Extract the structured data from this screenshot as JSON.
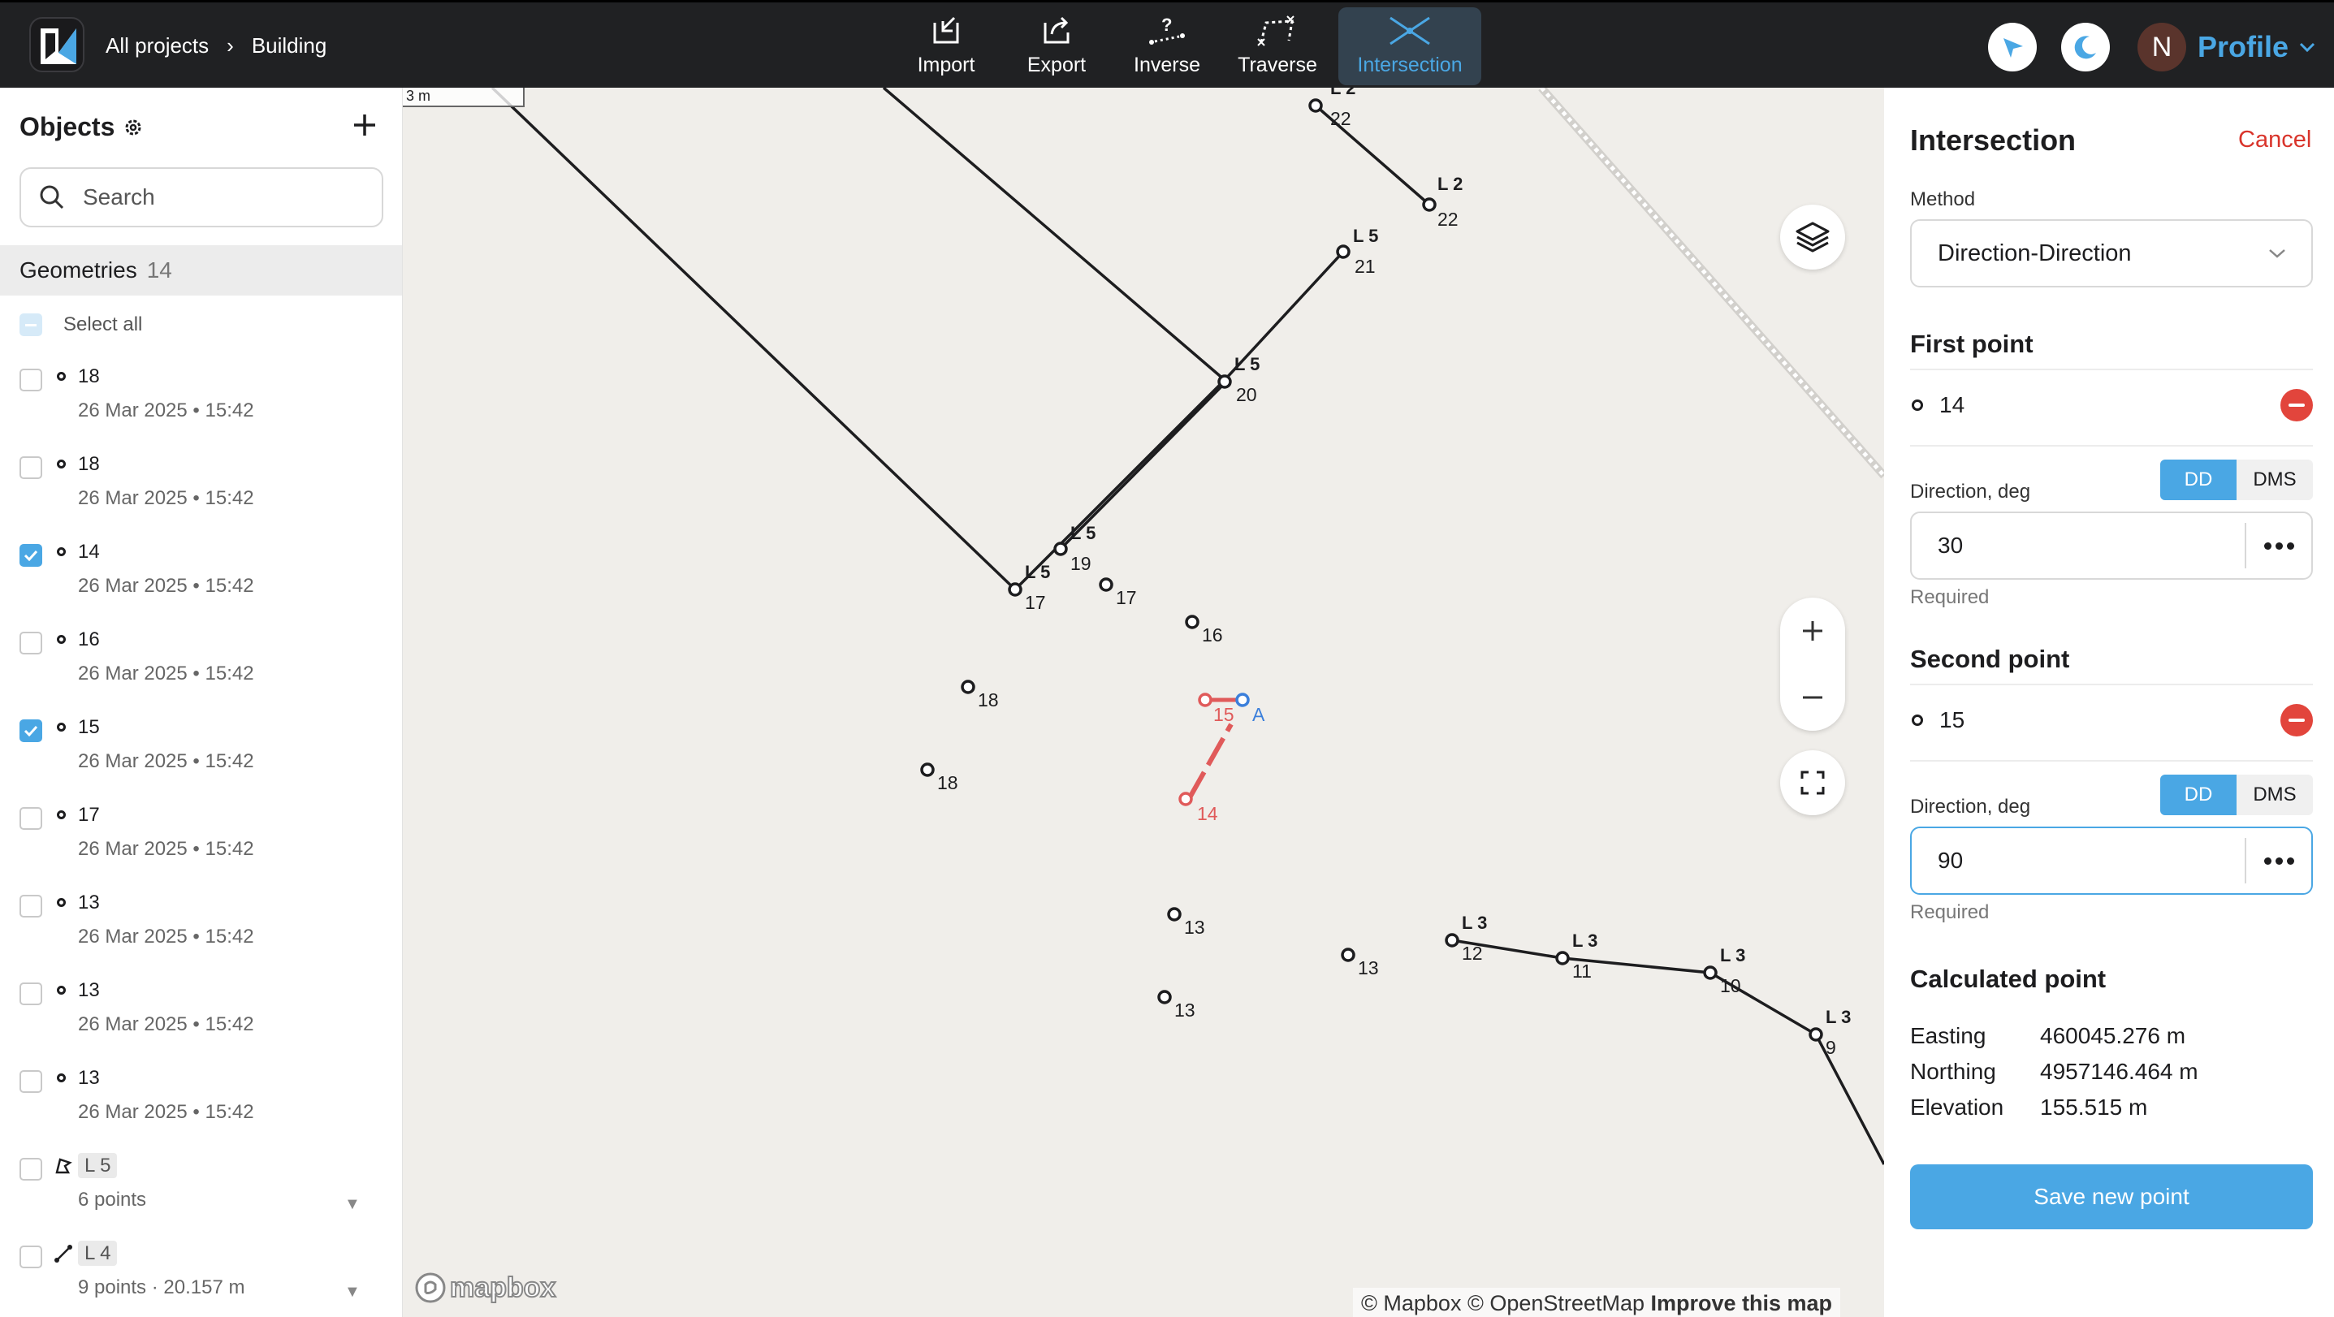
{
  "topbar": {
    "breadcrumb": [
      "All projects",
      "Building"
    ],
    "tools": [
      {
        "label": "Import",
        "icon": "import-icon"
      },
      {
        "label": "Export",
        "icon": "export-icon"
      },
      {
        "label": "Inverse",
        "icon": "inverse-icon"
      },
      {
        "label": "Traverse",
        "icon": "traverse-icon"
      },
      {
        "label": "Intersection",
        "icon": "intersection-icon",
        "active": true
      }
    ],
    "avatar_initial": "N",
    "profile_label": "Profile",
    "accent": "#4aa7e4"
  },
  "sidebar": {
    "title": "Objects",
    "search_placeholder": "Search",
    "geometries_label": "Geometries",
    "geometries_count": "14",
    "select_all": "Select all",
    "items": [
      {
        "name": "18",
        "meta": "26 Mar 2025 • 15:42",
        "checked": false
      },
      {
        "name": "18",
        "meta": "26 Mar 2025 • 15:42",
        "checked": false
      },
      {
        "name": "14",
        "meta": "26 Mar 2025 • 15:42",
        "checked": true
      },
      {
        "name": "16",
        "meta": "26 Mar 2025 • 15:42",
        "checked": false
      },
      {
        "name": "15",
        "meta": "26 Mar 2025 • 15:42",
        "checked": true
      },
      {
        "name": "17",
        "meta": "26 Mar 2025 • 15:42",
        "checked": false
      },
      {
        "name": "13",
        "meta": "26 Mar 2025 • 15:42",
        "checked": false
      },
      {
        "name": "13",
        "meta": "26 Mar 2025 • 15:42",
        "checked": false
      },
      {
        "name": "13",
        "meta": "26 Mar 2025 • 15:42",
        "checked": false
      },
      {
        "name": "L 5",
        "meta": "6 points",
        "type": "polygon",
        "checked": false
      },
      {
        "name": "L 4",
        "meta": "9 points · 20.157 m",
        "type": "line",
        "checked": false
      }
    ]
  },
  "map": {
    "scale_label": "3 m",
    "attribution": {
      "mapbox": "© Mapbox",
      "osm": "© OpenStreetMap",
      "improve": "Improve this map"
    },
    "logo_text": "mapbox",
    "line_labels": [
      "L 2",
      "22",
      "L 2",
      "22",
      "L 5",
      "21",
      "L 5",
      "20",
      "L 5",
      "19",
      "L 5",
      "17",
      "17",
      "16",
      "18",
      "18",
      "15",
      "A",
      "14",
      "13",
      "13",
      "13",
      "L 3",
      "12",
      "L 3",
      "11",
      "L 3",
      "10",
      "L 3",
      "9"
    ],
    "colors": {
      "line": "#1d1d1f",
      "selected": "#e05a5a",
      "calculated": "#3b7fdb"
    }
  },
  "panel": {
    "title": "Intersection",
    "cancel": "Cancel",
    "method_label": "Method",
    "method_value": "Direction-Direction",
    "first_point_title": "First point",
    "first_point_value": "14",
    "second_point_title": "Second point",
    "second_point_value": "15",
    "direction_label": "Direction, deg",
    "dd": "DD",
    "dms": "DMS",
    "first_direction": "30",
    "second_direction": "90",
    "required": "Required",
    "calculated_title": "Calculated point",
    "easting_label": "Easting",
    "easting_value": "460045.276 m",
    "northing_label": "Northing",
    "northing_value": "4957146.464 m",
    "elevation_label": "Elevation",
    "elevation_value": "155.515 m",
    "save_label": "Save new point"
  }
}
